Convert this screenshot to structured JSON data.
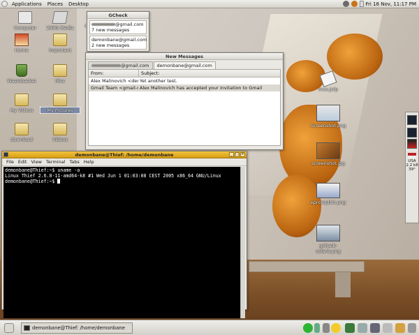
{
  "top_panel": {
    "menus": [
      "Applications",
      "Places",
      "Desktop"
    ],
    "clock": "Fri 18 Nov, 11:17 PM"
  },
  "desktop_icons": [
    {
      "label": "Computer"
    },
    {
      "label": "293G Media"
    },
    {
      "label": "Home"
    },
    {
      "label": "Important"
    },
    {
      "label": "Wastebasket"
    },
    {
      "label": "Misc"
    },
    {
      "label": "My Videos"
    },
    {
      "label": "My Pictures"
    },
    {
      "label": "download"
    },
    {
      "label": "Videos"
    },
    {
      "label": "mco.jnlp"
    },
    {
      "label": "Screenshot.png"
    },
    {
      "label": "screenshot.jpg"
    },
    {
      "label": "epromptlet.png"
    },
    {
      "label": "gcheck-solaris.png"
    },
    {
      "label": "4"
    }
  ],
  "gcheck": {
    "title": "GCheck",
    "accounts": [
      {
        "address": "@gmail.com",
        "status": "7 new messages"
      },
      {
        "address": "demonbane@gmail.com",
        "status": "2 new messages"
      }
    ]
  },
  "new_messages": {
    "title": "New Messages",
    "tabs": [
      "@gmail.com",
      "demonbane@gmail.com"
    ],
    "columns": [
      "From:",
      "Subject:"
    ],
    "rows": [
      {
        "from": "Alex Malinovich <demor",
        "subject": "Yet another test."
      },
      {
        "from": "Gmail Team <gmail-nor",
        "subject": "Alex Malinovich has accepted your invitation to Gmail"
      }
    ]
  },
  "terminal": {
    "title": "demonbane@Thief: /home/demonbane",
    "menu": [
      "File",
      "Edit",
      "View",
      "Terminal",
      "Tabs",
      "Help"
    ],
    "lines": [
      "demonbane@Thief:~$ uname -a",
      "Linux Thief 2.6.8-11-amd64-k8 #1 Wed Jun 1 01:03:08 CEST 2005 x86_64 GNU/Linux",
      "demonbane@Thief:~$ "
    ]
  },
  "bottom_panel": {
    "task_label": "demonbane@Thief: /home/demonbane"
  },
  "right_dock": {
    "labels": [
      "USA",
      "2.2 k8",
      "39°"
    ]
  }
}
